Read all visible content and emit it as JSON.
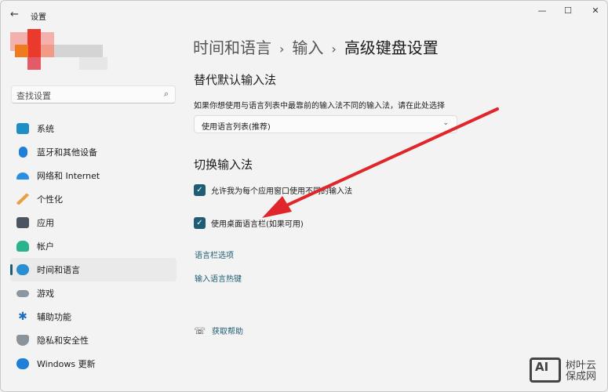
{
  "window": {
    "title": "设置",
    "back_icon": "back-arrow-icon",
    "controls": [
      "minimize",
      "maximize",
      "close"
    ]
  },
  "search": {
    "placeholder": "查找设置"
  },
  "sidebar": {
    "items": [
      {
        "label": "系统",
        "icon": "system-icon",
        "color": "#1d8fc4"
      },
      {
        "label": "蓝牙和其他设备",
        "icon": "bluetooth-icon",
        "color": "#1f7fd6"
      },
      {
        "label": "网络和 Internet",
        "icon": "wifi-icon",
        "color": "#2a8fe0"
      },
      {
        "label": "个性化",
        "icon": "brush-icon",
        "color": "#e8a040"
      },
      {
        "label": "应用",
        "icon": "apps-icon",
        "color": "#4a5560"
      },
      {
        "label": "帐户",
        "icon": "account-icon",
        "color": "#2bb38f"
      },
      {
        "label": "时间和语言",
        "icon": "time-language-icon",
        "color": "#2a8fd0",
        "selected": true
      },
      {
        "label": "游戏",
        "icon": "gamepad-icon",
        "color": "#8a96a2"
      },
      {
        "label": "辅助功能",
        "icon": "accessibility-icon",
        "color": "#1f6fc0"
      },
      {
        "label": "隐私和安全性",
        "icon": "shield-icon",
        "color": "#8a929a"
      },
      {
        "label": "Windows 更新",
        "icon": "update-icon",
        "color": "#1f7fd6"
      }
    ]
  },
  "breadcrumb": [
    "时间和语言",
    "输入",
    "高级键盘设置"
  ],
  "section1": {
    "title": "替代默认输入法",
    "desc": "如果你想使用与语言列表中最靠前的输入法不同的输入法，请在此处选择",
    "select_value": "使用语言列表(推荐)"
  },
  "section2": {
    "title": "切换输入法",
    "checkboxes": [
      {
        "label": "允许我为每个应用窗口使用不同的输入法",
        "checked": true
      },
      {
        "label": "使用桌面语言栏(如果可用)",
        "checked": true
      }
    ],
    "links": [
      "语言栏选项",
      "输入语言热键"
    ]
  },
  "help": "获取帮助",
  "watermark": {
    "logo": "AI",
    "text1": "树叶云",
    "text2": "保成网"
  }
}
